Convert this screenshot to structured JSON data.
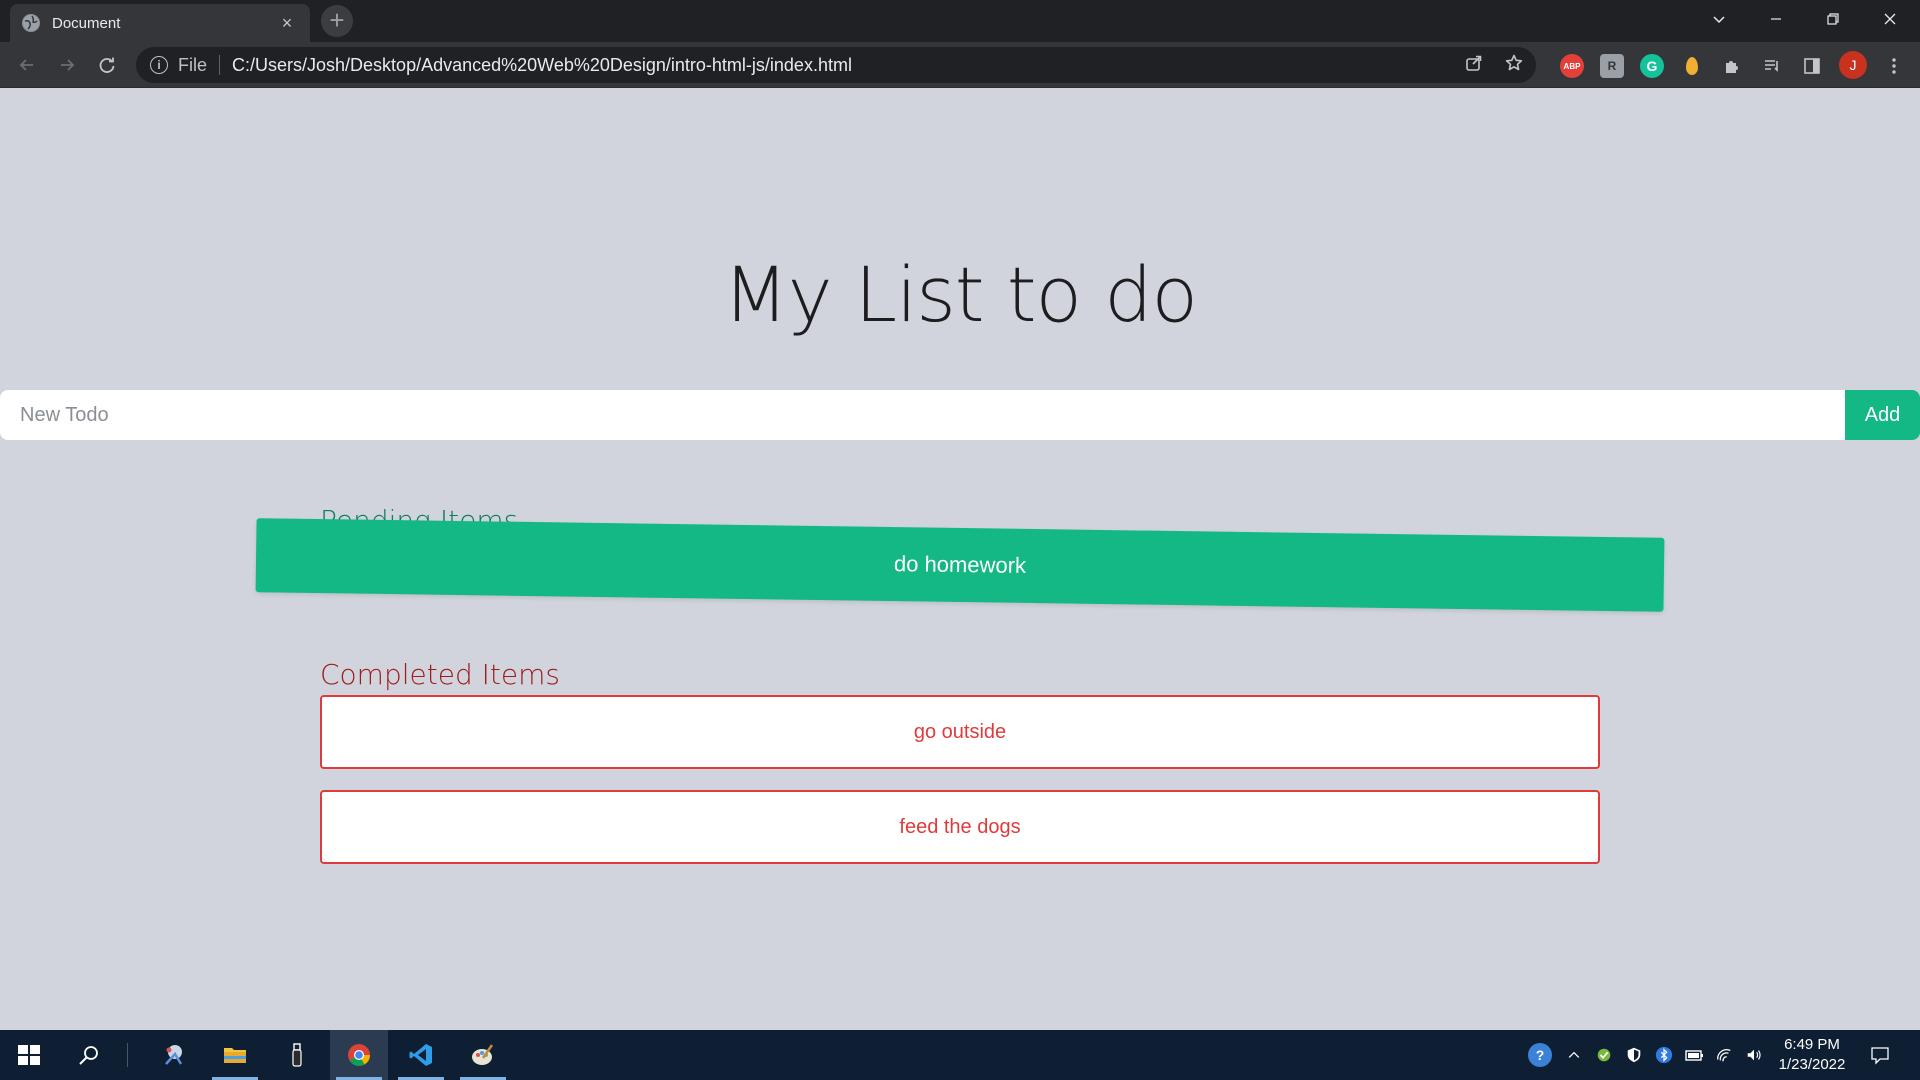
{
  "browser": {
    "tab_title": "Document",
    "tab_close": "×",
    "new_tab": "+",
    "scheme_label": "File",
    "url": "C:/Users/Josh/Desktop/Advanced%20Web%20Design/intro-html-js/index.html",
    "extensions": {
      "abp": "ABP",
      "box": "R",
      "grammarly": "G"
    },
    "profile_initial": "J"
  },
  "app": {
    "title": "My List to do",
    "input_placeholder": "New Todo",
    "input_value": "",
    "add_label": "Add",
    "pending": {
      "heading": "Pending Items",
      "items": [
        "do homework"
      ]
    },
    "completed": {
      "heading": "Completed Items",
      "items": [
        "go outside",
        "feed the dogs"
      ]
    }
  },
  "taskbar": {
    "time": "6:49 PM",
    "date": "1/23/2022"
  },
  "colors": {
    "accent_green": "#13b885",
    "completed_red": "#e03b3b",
    "page_bg": "#d1d4dc"
  }
}
